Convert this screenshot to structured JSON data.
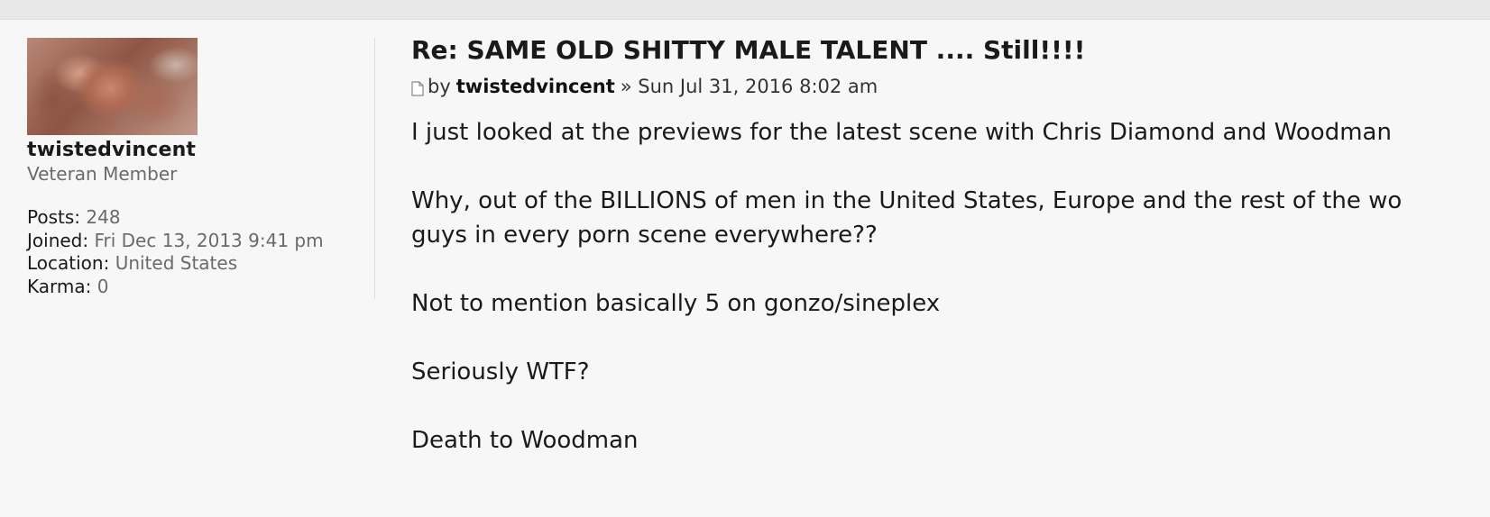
{
  "profile": {
    "username": "twistedvincent",
    "rank": "Veteran Member",
    "stats": [
      {
        "label": "Posts:",
        "value": "248"
      },
      {
        "label": "Joined:",
        "value": "Fri Dec 13, 2013 9:41 pm"
      },
      {
        "label": "Location:",
        "value": "United States"
      },
      {
        "label": "Karma:",
        "value": "0"
      }
    ]
  },
  "post": {
    "title": "Re: SAME OLD SHITTY MALE TALENT .... Still!!!!",
    "by_label": "by",
    "author": "twistedvincent",
    "date_text": "» Sun Jul 31, 2016 8:02 am",
    "icon": "post-icon",
    "paragraphs": [
      "I just looked at the previews for the latest scene with Chris Diamond and Woodman",
      "Why, out of the BILLIONS of men in the United States, Europe and the rest of the wo",
      "guys in every porn scene everywhere??",
      "Not to mention basically 5 on gonzo/sineplex",
      "Seriously WTF?",
      "Death to Woodman"
    ]
  },
  "colors": {
    "background": "#f7f7f7",
    "muted_text": "#6a6a6a",
    "text": "#1a1a1a"
  }
}
